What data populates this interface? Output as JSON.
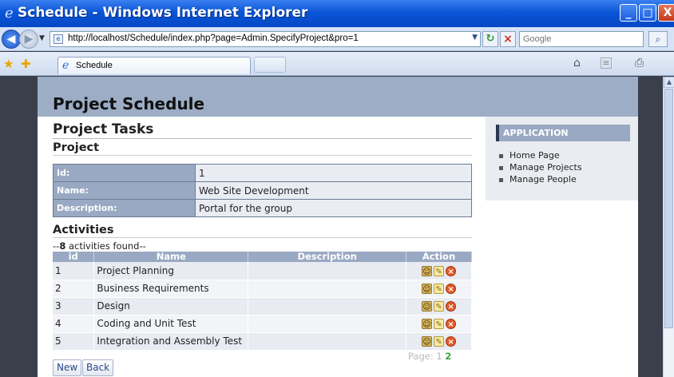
{
  "window": {
    "title": "Schedule - Windows Internet Explorer",
    "buttons": {
      "minimize": "_",
      "maximize": "□",
      "close": "X"
    }
  },
  "addressbar": {
    "url": "http://localhost/Schedule/index.php?page=Admin.SpecifyProject&pro=1",
    "search_placeholder": "Google"
  },
  "tabs": [
    {
      "label": "Schedule"
    }
  ],
  "page": {
    "site_title": "Project Schedule",
    "section_title": "Project Tasks",
    "project_heading": "Project",
    "project_fields": [
      {
        "label": "Id:",
        "value": "1"
      },
      {
        "label": "Name:",
        "value": "Web Site Development"
      },
      {
        "label": "Description:",
        "value": "Portal for the group"
      }
    ],
    "activities_heading": "Activities",
    "found_prefix": "--",
    "found_count": "8",
    "found_suffix": " activities found--",
    "columns": {
      "id": "id",
      "name": "Name",
      "description": "Description",
      "action": "Action"
    },
    "activities": [
      {
        "id": "1",
        "name": "Project Planning",
        "description": ""
      },
      {
        "id": "2",
        "name": "Business Requirements",
        "description": ""
      },
      {
        "id": "3",
        "name": "Design",
        "description": ""
      },
      {
        "id": "4",
        "name": "Coding and Unit Test",
        "description": ""
      },
      {
        "id": "5",
        "name": "Integration and Assembly Test",
        "description": ""
      }
    ],
    "pager": {
      "label": "Page:",
      "current": "1",
      "next": "2"
    },
    "buttons": {
      "new": "New",
      "back": "Back"
    }
  },
  "sidebar": {
    "title": "APPLICATION",
    "items": [
      "Home Page",
      "Manage Projects",
      "Manage People"
    ]
  },
  "colors": {
    "header_bg": "#9cadc5",
    "table_header": "#9aa9c3",
    "ie_titlebar": "#0a55d8"
  }
}
